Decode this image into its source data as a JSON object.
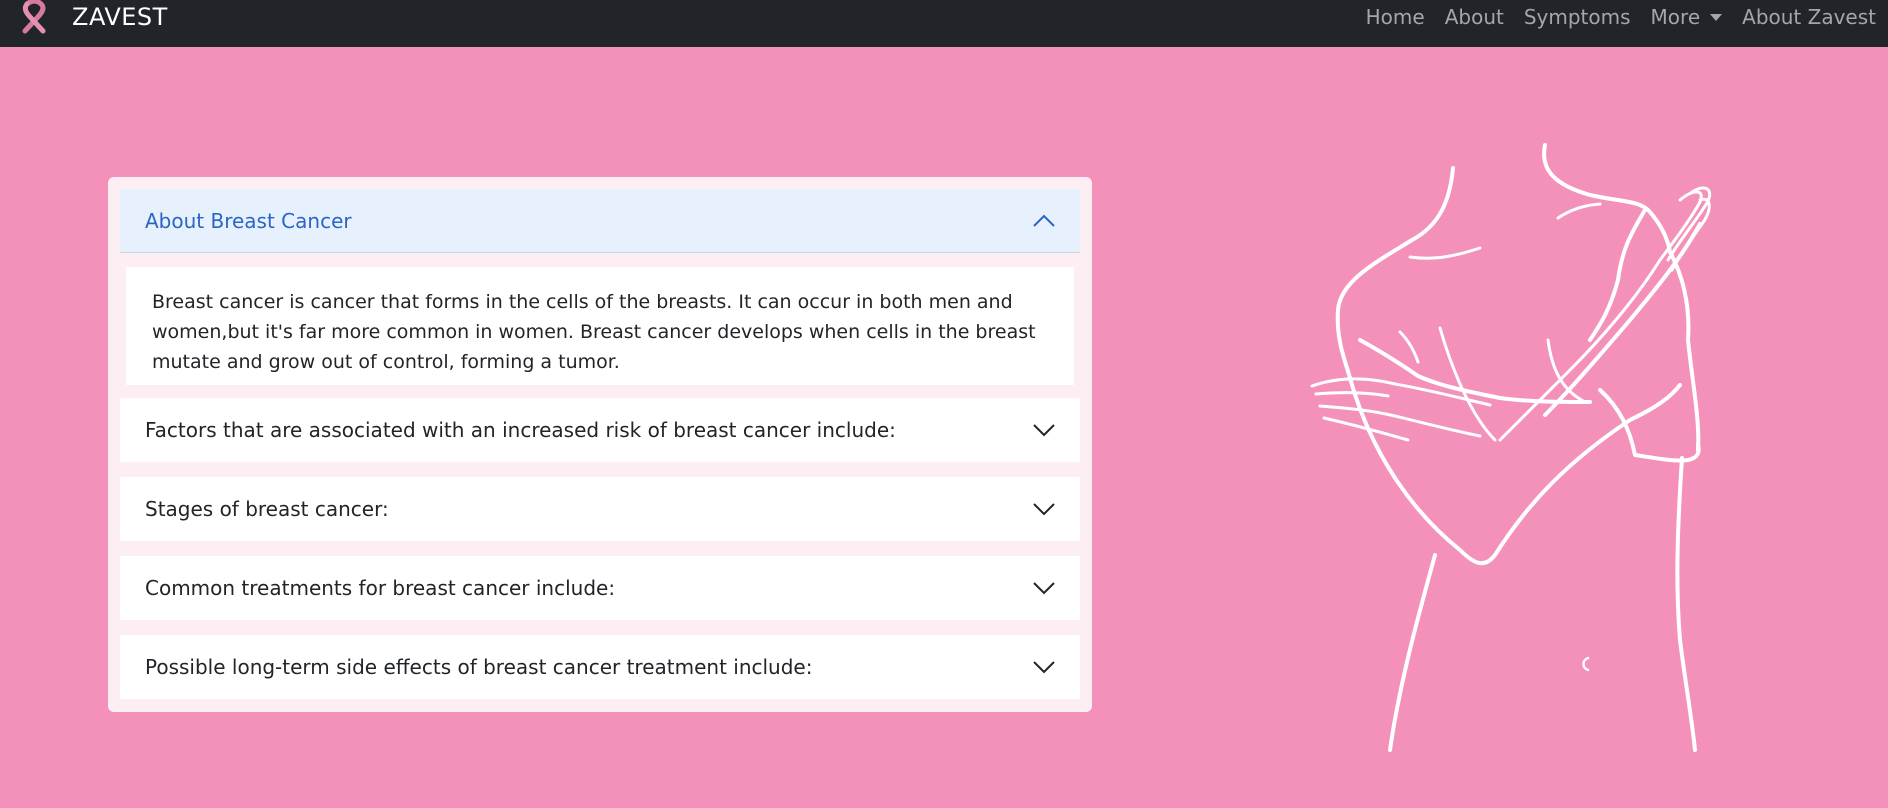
{
  "navbar": {
    "brand": "ZAVEST",
    "logo_icon": "pink-ribbon-icon",
    "links": [
      {
        "label": "Home"
      },
      {
        "label": "About"
      },
      {
        "label": "Symptoms"
      },
      {
        "label": "More"
      },
      {
        "label": "About Zavest"
      }
    ]
  },
  "accordion": {
    "items": [
      {
        "title": "About Breast Cancer",
        "expanded": true,
        "body": "Breast cancer is cancer that forms in the cells of the breasts. It can occur in both men and women,but it's far more common in women. Breast cancer develops when cells in the breast mutate and grow out of control, forming a tumor."
      },
      {
        "title": "Factors that are associated with an increased risk of breast cancer include:",
        "expanded": false
      },
      {
        "title": "Stages of breast cancer:",
        "expanded": false
      },
      {
        "title": "Common treatments for breast cancer include:",
        "expanded": false
      },
      {
        "title": "Possible long-term side effects of breast cancer treatment include:",
        "expanded": false
      }
    ]
  },
  "colors": {
    "background": "#f491bb",
    "navbar": "#212529",
    "accent": "#2a65c1",
    "active_header": "#e7f1fe"
  }
}
